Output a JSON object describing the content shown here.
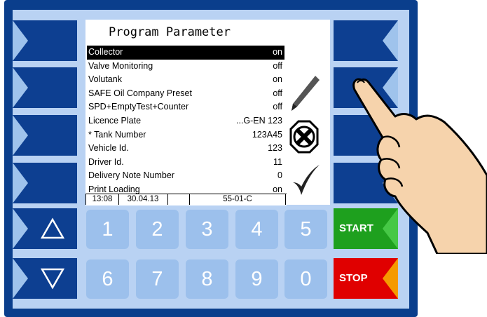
{
  "screen": {
    "title": "Program Parameter",
    "rows": [
      {
        "label": "Collector",
        "value": "on",
        "selected": true
      },
      {
        "label": "Valve Monitoring",
        "value": "off"
      },
      {
        "label": "Volutank",
        "value": "on"
      },
      {
        "label": "SAFE Oil Company Preset",
        "value": "off"
      },
      {
        "label": "SPD+EmptyTest+Counter",
        "value": "off"
      },
      {
        "label": "Licence Plate",
        "value": "...G-EN 123"
      },
      {
        "label": "* Tank Number",
        "value": "123A45"
      },
      {
        "label": "Vehicle Id.",
        "value": "123"
      },
      {
        "label": "Driver Id.",
        "value": "11"
      },
      {
        "label": "Delivery Note Number",
        "value": "0"
      },
      {
        "label": "Print Loading",
        "value": "on"
      }
    ],
    "status": {
      "time": "13:08",
      "date": "30.04.13",
      "blank": "",
      "code": "55-01-C"
    }
  },
  "numpad": {
    "keys_top": [
      "1",
      "2",
      "3",
      "4",
      "5"
    ],
    "keys_bottom": [
      "6",
      "7",
      "8",
      "9",
      "0"
    ]
  },
  "controls": {
    "start_label": "START",
    "stop_label": "STOP"
  },
  "icons": [
    "pencil-icon",
    "cancel-x-icon",
    "checkmark-icon",
    "up-arrow-icon",
    "down-arrow-icon",
    "pointing-hand-icon"
  ],
  "colors": {
    "frame": "#0a3e8c",
    "panel": "#b9d2f3",
    "key": "#9cc0ec",
    "start": "#1ea01e",
    "stop": "#e00000",
    "stop_accent": "#f59a00"
  }
}
